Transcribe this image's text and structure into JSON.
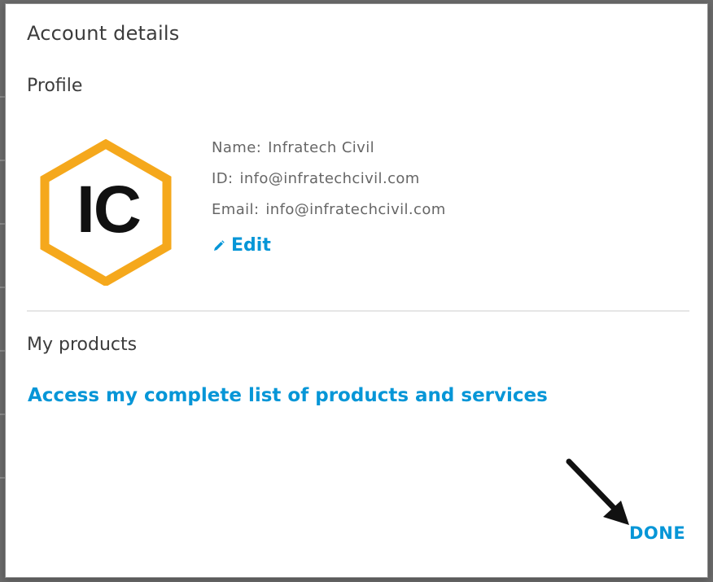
{
  "dialog": {
    "title": "Account details",
    "profile": {
      "section_title": "Profile",
      "logo_text": "IC",
      "name_label": "Name:",
      "name_value": "Infratech Civil",
      "id_label": "ID:",
      "id_value": "info@infratechcivil.com",
      "email_label": "Email:",
      "email_value": "info@infratechcivil.com",
      "edit_label": "Edit",
      "edit_icon": "pencil-icon"
    },
    "products": {
      "section_title": "My products",
      "link_text": "Access my complete list of products and services"
    },
    "done_label": "DONE"
  },
  "colors": {
    "accent": "#0696d7",
    "logo_hex": "#f5a81c",
    "logo_text": "#111111",
    "heading": "#3c3c3c",
    "body_text": "#666666"
  }
}
